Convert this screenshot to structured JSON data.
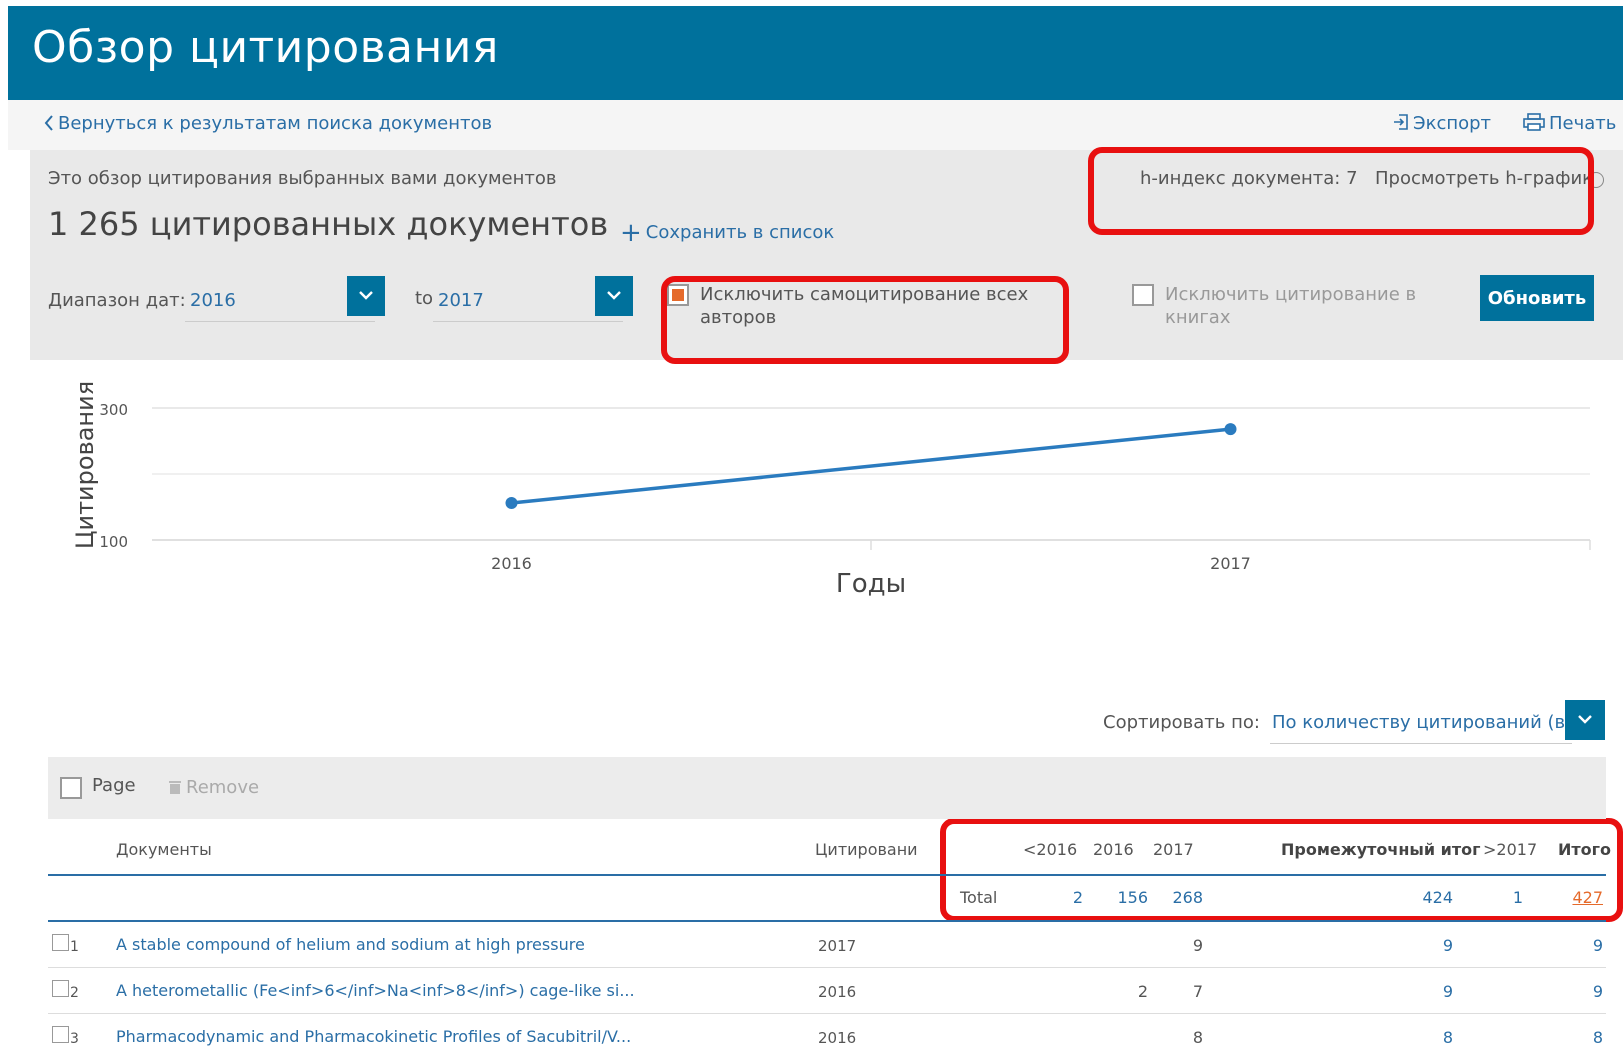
{
  "header": {
    "title": "Обзор цитирования"
  },
  "nav": {
    "back": "Вернуться к результатам поиска документов",
    "export": "Экспорт",
    "print": "Печать"
  },
  "summary": {
    "intro": "Это обзор цитирования выбранных вами документов",
    "count": "1 265 цитированных документов",
    "save_to_list": "Сохранить в список",
    "save_plus": "+",
    "hindex": "h-индекс документа: 7",
    "hgraph": "Просмотреть h-график"
  },
  "filters": {
    "date_label": "Диапазон дат:",
    "from": "2016",
    "to_label": "to",
    "to": "2017",
    "exclude_self": "Исключить самоцитирование всех авторов",
    "exclude_self_checked": true,
    "exclude_books": "Исключить цитирование в книгах",
    "exclude_books_checked": false,
    "refresh": "Обновить"
  },
  "chart_data": {
    "type": "line",
    "ylabel": "Цитирования",
    "xlabel": "Годы",
    "categories": [
      "2016",
      "2017"
    ],
    "values": [
      156,
      268
    ],
    "yticks": [
      "300",
      "100"
    ],
    "ylim": [
      100,
      300
    ],
    "color": "#2a7bbf"
  },
  "sort": {
    "label": "Сортировать по:",
    "value": "По количеству цитирований (в..."
  },
  "toolbar": {
    "page": "Page",
    "remove": "Remove"
  },
  "table": {
    "headers": {
      "docs": "Документы",
      "cites": "Цитировани",
      "lt": "<2016",
      "y2016": "2016",
      "y2017": "2017",
      "subtotal": "Промежуточный итог",
      "gt": ">2017",
      "total": "Итого"
    },
    "total_row": {
      "label": "Total",
      "lt": "2",
      "y2016": "156",
      "y2017": "268",
      "subtotal": "424",
      "gt": "1",
      "total": "427"
    },
    "rows": [
      {
        "num": "1",
        "title": "A stable compound of helium and sodium at high pressure",
        "year": "2017",
        "y2016": "",
        "y2017": "9",
        "subtotal": "9",
        "total": "9"
      },
      {
        "num": "2",
        "title": "A heterometallic (Fe<inf>6</inf>Na<inf>8</inf>) cage-like si...",
        "year": "2016",
        "y2016": "2",
        "y2017": "7",
        "subtotal": "9",
        "total": "9"
      },
      {
        "num": "3",
        "title": "Pharmacodynamic and Pharmacokinetic Profiles of Sacubitril/V...",
        "year": "2016",
        "y2016": "",
        "y2017": "8",
        "subtotal": "8",
        "total": "8"
      }
    ]
  },
  "colors": {
    "brand": "#00719c",
    "link": "#2a6ea6",
    "accent": "#e56a2b",
    "highlight": "#e81010"
  }
}
